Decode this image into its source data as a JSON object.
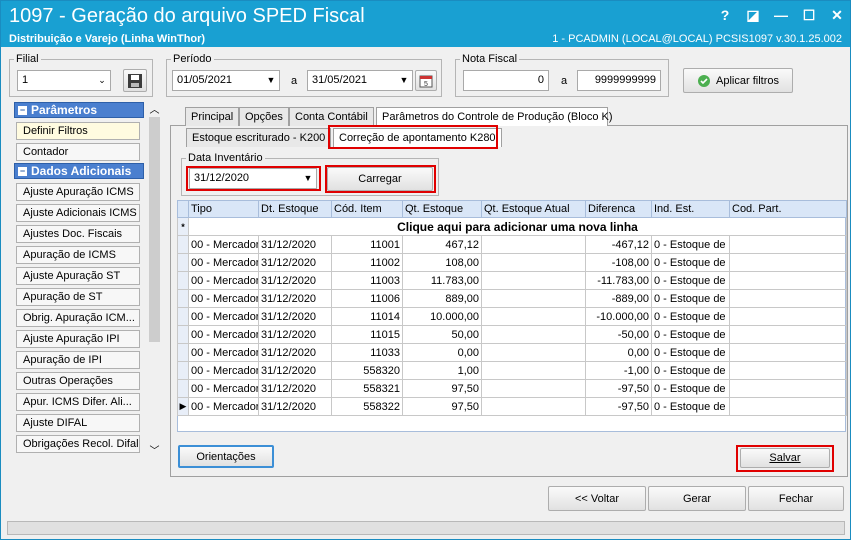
{
  "window": {
    "title": "1097 - Geração do arquivo SPED Fiscal",
    "subtitle": "Distribuição e Varejo (Linha WinThor)",
    "status_right": "1 - PCADMIN (LOCAL@LOCAL)   PCSIS1097  v.30.1.25.002",
    "controls": [
      "?",
      "◪",
      "—",
      "☐",
      "✕"
    ]
  },
  "filial": {
    "label": "Filial",
    "value": "1"
  },
  "periodo": {
    "label": "Período",
    "start": "01/05/2021",
    "sep": "a",
    "end": "31/05/2021"
  },
  "nota_fiscal": {
    "label": "Nota Fiscal",
    "start": "0",
    "sep": "a",
    "end": "9999999999"
  },
  "aplicar_filtros": "Aplicar filtros",
  "sidebar": {
    "parametros_header": "Parâmetros",
    "parametros_items": [
      "Definir Filtros",
      "Contador"
    ],
    "dados_header": "Dados Adicionais",
    "dados_items": [
      "Ajuste Apuração ICMS",
      "Ajuste Adicionais ICMS",
      "Ajustes Doc. Fiscais",
      "Apuração de ICMS",
      "Ajuste Apuração ST",
      "Apuração de ST",
      "Obrig. Apuração ICM...",
      "Ajuste Apuração IPI",
      "Apuração de IPI",
      "Outras Operações",
      "Apur. ICMS Difer. Ali...",
      "Ajuste DIFAL",
      "Obrigações Recol. Difal"
    ]
  },
  "tabs": [
    "Principal",
    "Opções",
    "Conta Contábil",
    "Parâmetros do Controle de Produção (Bloco K)"
  ],
  "subtabs": [
    "Estoque escriturado - K200",
    "Correção de apontamento K280"
  ],
  "data_inventario": {
    "label": "Data Inventário",
    "value": "31/12/2020"
  },
  "carregar": "Carregar",
  "grid": {
    "columns": [
      "Tipo",
      "Dt. Estoque",
      "Cód. Item",
      "Qt. Estoque",
      "Qt. Estoque Atual",
      "Diferenca",
      "Ind. Est.",
      "Cod. Part."
    ],
    "new_row_text": "Clique aqui para adicionar uma nova linha",
    "rows": [
      [
        "00 - Mercador",
        "31/12/2020",
        "11001",
        "467,12",
        "",
        "-467,12",
        "0 -  Estoque de",
        ""
      ],
      [
        "00 - Mercador",
        "31/12/2020",
        "11002",
        "108,00",
        "",
        "-108,00",
        "0 -  Estoque de",
        ""
      ],
      [
        "00 - Mercador",
        "31/12/2020",
        "11003",
        "11.783,00",
        "",
        "-11.783,00",
        "0 -  Estoque de",
        ""
      ],
      [
        "00 - Mercador",
        "31/12/2020",
        "11006",
        "889,00",
        "",
        "-889,00",
        "0 -  Estoque de",
        ""
      ],
      [
        "00 - Mercador",
        "31/12/2020",
        "11014",
        "10.000,00",
        "",
        "-10.000,00",
        "0 -  Estoque de",
        ""
      ],
      [
        "00 - Mercador",
        "31/12/2020",
        "11015",
        "50,00",
        "",
        "-50,00",
        "0 -  Estoque de",
        ""
      ],
      [
        "00 - Mercador",
        "31/12/2020",
        "11033",
        "0,00",
        "",
        "0,00",
        "0 -  Estoque de",
        ""
      ],
      [
        "00 - Mercador",
        "31/12/2020",
        "558320",
        "1,00",
        "",
        "-1,00",
        "0 -  Estoque de",
        ""
      ],
      [
        "00 - Mercador",
        "31/12/2020",
        "558321",
        "97,50",
        "",
        "-97,50",
        "0 -  Estoque de",
        ""
      ],
      [
        "00 - Mercador",
        "31/12/2020",
        "558322",
        "97,50",
        "",
        "-97,50",
        "0 -  Estoque de",
        ""
      ]
    ]
  },
  "orientacoes": "Orientações",
  "salvar": "Salvar",
  "footer_buttons": {
    "voltar": "<< Voltar",
    "gerar": "Gerar",
    "fechar": "Fechar"
  }
}
